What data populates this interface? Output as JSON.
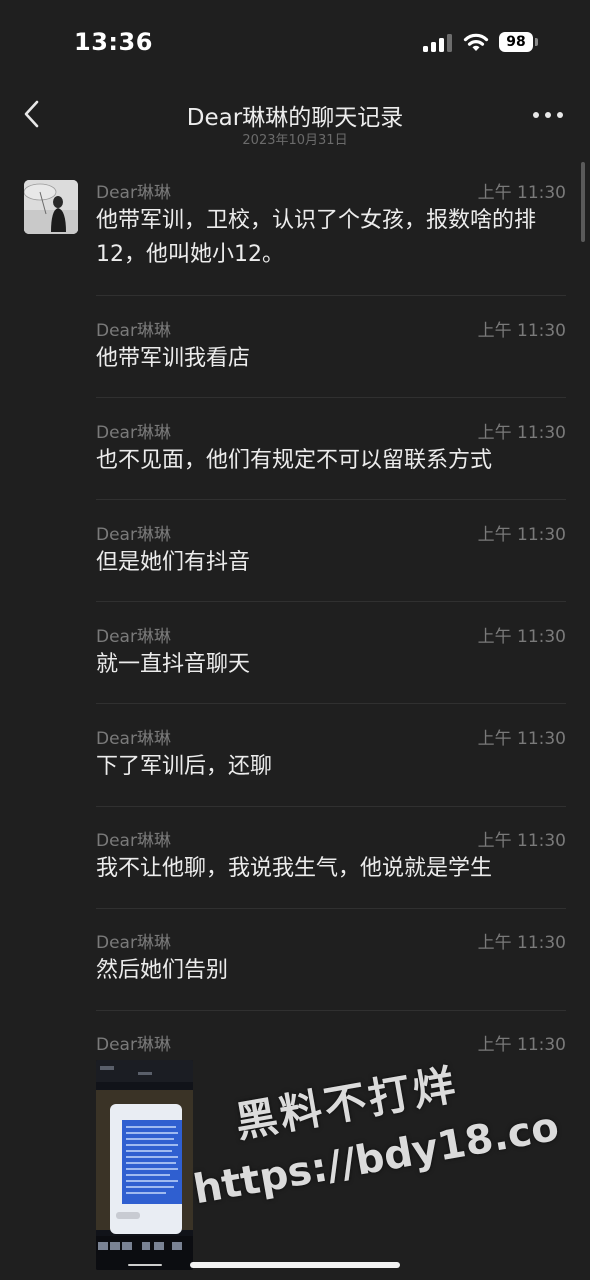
{
  "status": {
    "time": "13:36",
    "battery": "98"
  },
  "nav": {
    "title": "Dear琳琳的聊天记录",
    "subtitle": "2023年10月31日"
  },
  "messages": [
    {
      "sender": "Dear琳琳",
      "time": "上午 11:30",
      "text": "他带军训，卫校，认识了个女孩，报数啥的排12，他叫她小12。"
    },
    {
      "sender": "Dear琳琳",
      "time": "上午 11:30",
      "text": "他带军训我看店"
    },
    {
      "sender": "Dear琳琳",
      "time": "上午 11:30",
      "text": "也不见面，他们有规定不可以留联系方式"
    },
    {
      "sender": "Dear琳琳",
      "time": "上午 11:30",
      "text": "但是她们有抖音"
    },
    {
      "sender": "Dear琳琳",
      "time": "上午 11:30",
      "text": "就一直抖音聊天"
    },
    {
      "sender": "Dear琳琳",
      "time": "上午 11:30",
      "text": "下了军训后，还聊"
    },
    {
      "sender": "Dear琳琳",
      "time": "上午 11:30",
      "text": "我不让他聊，我说我生气，他说就是学生"
    },
    {
      "sender": "Dear琳琳",
      "time": "上午 11:30",
      "text": "然后她们告别"
    },
    {
      "sender": "Dear琳琳",
      "time": "上午 11:30",
      "text": ""
    }
  ],
  "watermark": {
    "line1": "黑料不打烊",
    "line2": "https://bdy18.co"
  },
  "icons": {
    "back": "chevron-left-icon",
    "more": "more-dots-icon",
    "wifi": "wifi-icon",
    "signal": "signal-icon",
    "battery": "battery-icon"
  }
}
